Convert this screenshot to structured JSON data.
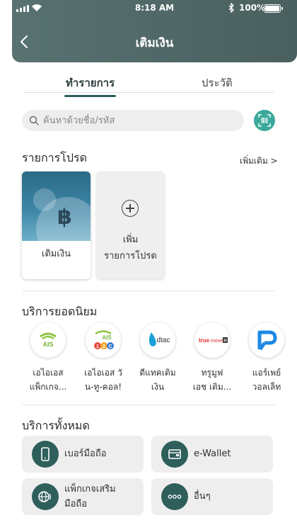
{
  "status_bar": {
    "time": "8:18 AM",
    "battery": "100%"
  },
  "header": {
    "title": "เติมเงิน"
  },
  "tabs": [
    {
      "label": "ทำรายการ",
      "active": true
    },
    {
      "label": "ประวัติ",
      "active": false
    }
  ],
  "search": {
    "placeholder": "ค้นหาด้วยชื่อ/รหัส"
  },
  "favorites": {
    "title": "รายการโปรด",
    "more": "เพิ่มเติม >",
    "items": [
      {
        "label": "เติมเงิน",
        "icon": "baht-icon"
      }
    ],
    "add_label_line1": "เพิ่ม",
    "add_label_line2": "รายการโปรด"
  },
  "popular": {
    "title": "บริการยอดนิยม",
    "items": [
      {
        "line1": "เอไอเอส",
        "line2": "แพ็กเกจ...",
        "logo": "AIS"
      },
      {
        "line1": "เอไอเอส วั",
        "line2": "น-ทู-คอล!",
        "logo": "AIS 12C"
      },
      {
        "line1": "ดีแทคเติม",
        "line2": "เงิน",
        "logo": "dtac"
      },
      {
        "line1": "ทรูมูฟ",
        "line2": "เอช เติม...",
        "logo": "truemove H"
      },
      {
        "line1": "แอร์เพย์",
        "line2": "วอลเล็ท",
        "logo": "airpay"
      }
    ]
  },
  "all_services": {
    "title": "บริการทั้งหมด",
    "items": [
      {
        "label": "เบอร์มือถือ",
        "icon": "mobile-phone-icon"
      },
      {
        "label": "e-Wallet",
        "icon": "wallet-icon"
      },
      {
        "label_line1": "แพ็กเกจเสริม",
        "label_line2": "มือถือ",
        "icon": "mobile-package-icon"
      },
      {
        "label": "อื่นๆ",
        "icon": "more-dots-icon"
      }
    ]
  },
  "colors": {
    "header": "#567070",
    "accent": "#2e5f5b",
    "scan": "#3aa99a"
  }
}
